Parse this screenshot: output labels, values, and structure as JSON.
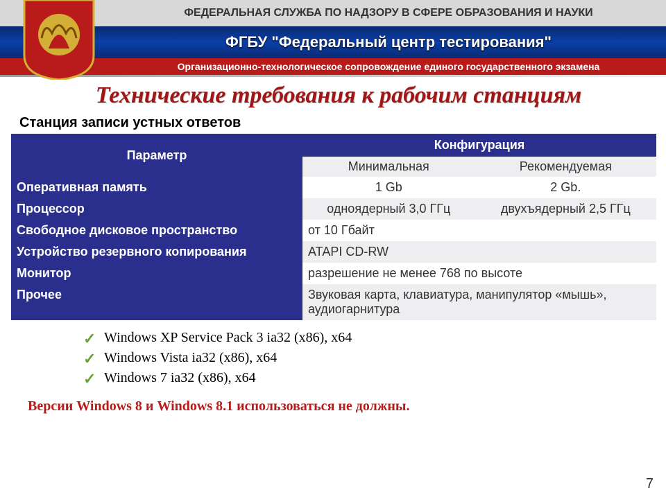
{
  "header": {
    "agency": "ФЕДЕРАЛЬНАЯ СЛУЖБА ПО НАДЗОРУ В СФЕРЕ ОБРАЗОВАНИЯ И НАУКИ",
    "org": "ФГБУ \"Федеральный центр тестирования\"",
    "tagline": "Организационно-технологическое сопровождение единого государственного экзамена"
  },
  "title": "Технические требования к рабочим станциям",
  "subtitle": "Станция записи устных ответов",
  "table": {
    "headers": {
      "param": "Параметр",
      "config": "Конфигурация",
      "min": "Минимальная",
      "rec": "Рекомендуемая"
    },
    "rows": {
      "ram_label": "Оперативная память",
      "ram_min": "1 Gb",
      "ram_rec": "2 Gb.",
      "cpu_label": "Процессор",
      "cpu_min": "одноядерный 3,0 ГГц",
      "cpu_rec": "двухъядерный 2,5 ГГц",
      "disk_label": "Свободное дисковое пространство",
      "disk_val": "от 10 Гбайт",
      "backup_label": "Устройство резервного копирования",
      "backup_val": "ATAPI CD-RW",
      "monitor_label": "Монитор",
      "monitor_val": "разрешение не менее 768 по высоте",
      "other_label": "Прочее",
      "other_val": "Звуковая карта, клавиатура, манипулятор «мышь», аудиогарнитура"
    }
  },
  "os_list": {
    "0": "Windows XP Service Pack 3 ia32 (x86), x64",
    "1": "Windows Vista ia32 (x86), x64",
    "2": "Windows 7 ia32 (x86), x64"
  },
  "warning": "Версии Windows 8 и Windows 8.1 использоваться не должны.",
  "page_number": "7"
}
